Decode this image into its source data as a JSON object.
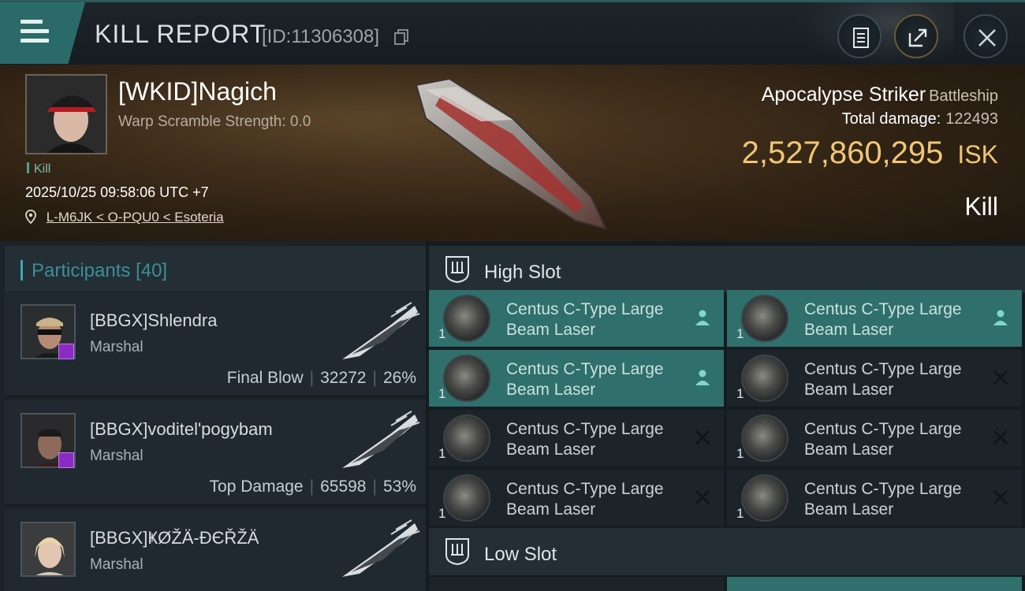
{
  "header": {
    "title": "KILL REPORT",
    "report_id": "[ID:11306308]"
  },
  "victim": {
    "name": "[WKID]Nagich",
    "subtitle": "Warp Scramble Strength: 0.0",
    "tag": "Kill",
    "datetime": "2025/10/25 09:58:06 UTC +7",
    "location": "L-M6JK < O-PQU0 < Esoteria",
    "ship_name": "Apocalypse Striker",
    "ship_class": "Battleship",
    "total_damage_label": "Total damage:",
    "total_damage": "122493",
    "isk_value": "2,527,860,295",
    "isk_unit": "ISK",
    "result": "Kill"
  },
  "participants": {
    "label": "Participants",
    "count": "[40]",
    "items": [
      {
        "name": "[BBGX]Shlendra",
        "rank": "Marshal",
        "role": "Final Blow",
        "damage": "32272",
        "percent": "26%"
      },
      {
        "name": "[BBGX]voditel'pogybam",
        "rank": "Marshal",
        "role": "Top Damage",
        "damage": "65598",
        "percent": "53%"
      },
      {
        "name": "[BBGX]ҜØŽÄ-ĐЄŘŽÄ",
        "rank": "Marshal",
        "role": "",
        "damage": "",
        "percent": ""
      }
    ]
  },
  "high_slot": {
    "label": "High Slot",
    "items": [
      {
        "qty": "1",
        "name": "Centus C-Type Large Beam Laser",
        "status": "person-icon",
        "active": true
      },
      {
        "qty": "1",
        "name": "Centus C-Type Large Beam Laser",
        "status": "person-icon",
        "active": true
      },
      {
        "qty": "1",
        "name": "Centus C-Type Large Beam Laser",
        "status": "person-icon",
        "active": true
      },
      {
        "qty": "1",
        "name": "Centus C-Type Large Beam Laser",
        "status": "destroyed-x-icon",
        "active": false
      },
      {
        "qty": "1",
        "name": "Centus C-Type Large Beam Laser",
        "status": "destroyed-x-icon",
        "active": false
      },
      {
        "qty": "1",
        "name": "Centus C-Type Large Beam Laser",
        "status": "destroyed-x-icon",
        "active": false
      },
      {
        "qty": "1",
        "name": "Centus C-Type Large Beam Laser",
        "status": "destroyed-x-icon",
        "active": false
      },
      {
        "qty": "1",
        "name": "Centus C-Type Large Beam Laser",
        "status": "destroyed-x-icon",
        "active": false
      }
    ]
  },
  "low_slot": {
    "label": "Low Slot"
  },
  "colors": {
    "accent_teal": "#2f6f6c",
    "isk_gold": "#f0c676",
    "badge_purple": "#8a2cc4"
  }
}
